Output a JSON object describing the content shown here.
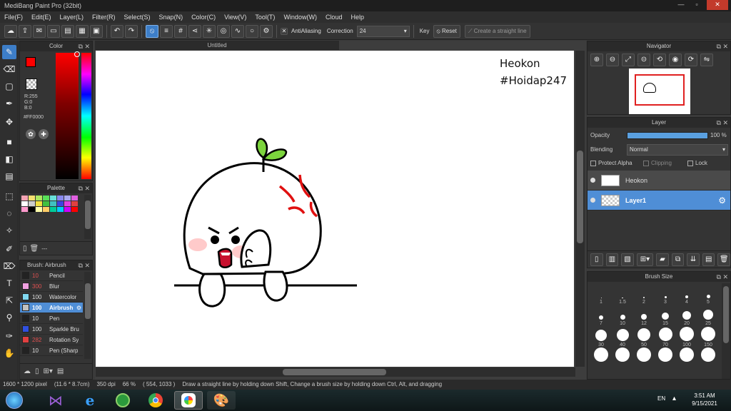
{
  "window": {
    "title": "MediBang Paint Pro (32bit)"
  },
  "menu": [
    "File(F)",
    "Edit(E)",
    "Layer(L)",
    "Filter(R)",
    "Select(S)",
    "Snap(N)",
    "Color(C)",
    "View(V)",
    "Tool(T)",
    "Window(W)",
    "Cloud",
    "Help"
  ],
  "toolbar": {
    "antialiasing_label": "AntiAliasing",
    "correction_label": "Correction",
    "correction_value": "24",
    "key_label": "Key",
    "reset_label": "Reset",
    "straight_line_label": "Create a straight line"
  },
  "color_panel": {
    "title": "Color",
    "r": "R:255",
    "g": "G:0",
    "b": "B:0",
    "hex": "#FF0000",
    "colors": {
      "primary": "#ff0000",
      "secondary": "#ff6600"
    }
  },
  "palette_panel": {
    "title": "Palette",
    "value": "---",
    "swatches": [
      "#f4a3b3",
      "#f5e070",
      "#ace860",
      "#58e058",
      "#68e0d8",
      "#8888ee",
      "#a8a8f0",
      "#e060e0",
      "#ffffff",
      "#cccccc",
      "#f0e040",
      "#40c040",
      "#40c0c0",
      "#4040e0",
      "#e040e0",
      "#e04040",
      "#ff99cc",
      "#000000",
      "#ffffaa",
      "#ffcc66",
      "#00cc99",
      "#00ccff",
      "#cc00ff",
      "#ff0000"
    ]
  },
  "brush_panel": {
    "title": "Brush: Airbrush",
    "brushes": [
      {
        "size": "10",
        "name": "Pencil",
        "color": "#222222"
      },
      {
        "size": "300",
        "name": "Blur",
        "color": "#f0a0e0"
      },
      {
        "size": "100",
        "name": "Watercolor",
        "color": "#80d8f0"
      },
      {
        "size": "100",
        "name": "Airbrush",
        "color": "#c0c0c0"
      },
      {
        "size": "10",
        "name": "Pen",
        "color": "#222222"
      },
      {
        "size": "100",
        "name": "Sparkle Bru",
        "color": "#3050e0"
      },
      {
        "size": "282",
        "name": "Rotation Sy",
        "color": "#e04040"
      },
      {
        "size": "10",
        "name": "Pen (Sharp",
        "color": "#222222"
      }
    ]
  },
  "document": {
    "tab_title": "Untitled",
    "watermark_line1": "Heokon",
    "watermark_line2": "#Hoidap247"
  },
  "navigator": {
    "title": "Navigator"
  },
  "layer_panel": {
    "title": "Layer",
    "opacity_label": "Opacity",
    "opacity_value": "100 %",
    "blending_label": "Blending",
    "blending_value": "Normal",
    "protect_alpha": "Protect Alpha",
    "clipping": "Clipping",
    "lock": "Lock",
    "layers": [
      {
        "name": "Heokon",
        "selected": false
      },
      {
        "name": "Layer1",
        "selected": true
      }
    ]
  },
  "brush_size_panel": {
    "title": "Brush Size",
    "sizes": [
      "1",
      "1.5",
      "2",
      "3",
      "4",
      "5",
      "7",
      "10",
      "12",
      "15",
      "20",
      "25",
      "30",
      "40",
      "50",
      "70",
      "100",
      "150"
    ]
  },
  "statusbar": {
    "size": "1600 * 1200 pixel",
    "physical": "(11.6 * 8.7cm)",
    "dpi": "350 dpi",
    "zoom": "66 %",
    "coords": "( 554, 1033 )",
    "hint": "Draw a straight line by holding down Shift, Change a brush size by holding down Ctrl, Alt, and dragging"
  },
  "taskbar": {
    "lang": "EN",
    "time": "3:51 AM",
    "date": "9/15/2021"
  }
}
